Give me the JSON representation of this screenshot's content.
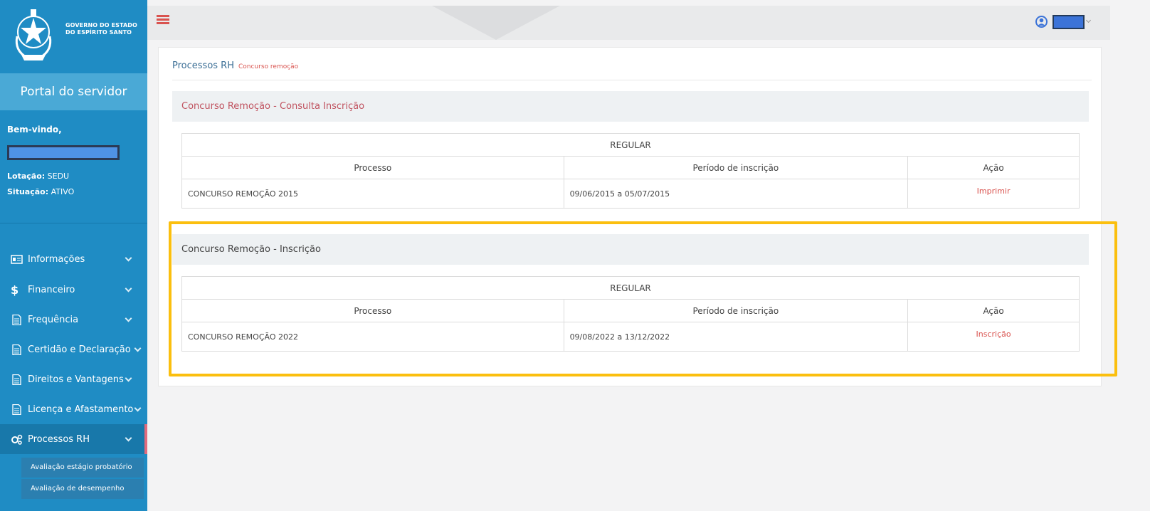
{
  "sidebar": {
    "gov_line1": "GOVERNO DO ESTADO",
    "gov_line2": "DO ESPÍRITO SANTO",
    "portal_title": "Portal do servidor",
    "welcome": "Bem-vindo,",
    "lotacao_label": "Lotação:",
    "lotacao_value": "SEDU",
    "situacao_label": "Situação:",
    "situacao_value": "ATIVO",
    "menu": [
      {
        "label": "Informações",
        "icon": "id-card-icon"
      },
      {
        "label": "Financeiro",
        "icon": "dollar-icon"
      },
      {
        "label": "Frequência",
        "icon": "document-icon"
      },
      {
        "label": "Certidão e Declaração",
        "icon": "document-icon"
      },
      {
        "label": "Direitos e Vantagens",
        "icon": "document-icon"
      },
      {
        "label": "Licença e Afastamento",
        "icon": "document-icon"
      },
      {
        "label": "Processos RH",
        "icon": "gears-icon"
      }
    ],
    "submenu": [
      "Avaliação estágio probatório",
      "Avaliação de desempenho"
    ]
  },
  "header": {
    "title": "Processos RH",
    "breadcrumb": "Concurso remoção"
  },
  "section_consulta": {
    "title": "Concurso Remoção - Consulta Inscrição",
    "group": "REGULAR",
    "columns": [
      "Processo",
      "Período de inscrição",
      "Ação"
    ],
    "rows": [
      {
        "processo": "CONCURSO REMOÇÃO 2015",
        "periodo": "09/06/2015 a 05/07/2015",
        "acao": "Imprimir"
      }
    ]
  },
  "section_inscricao": {
    "title": "Concurso Remoção - Inscrição",
    "group": "REGULAR",
    "columns": [
      "Processo",
      "Período de inscrição",
      "Ação"
    ],
    "rows": [
      {
        "processo": "CONCURSO REMOÇÃO 2022",
        "periodo": "09/08/2022 a 13/12/2022",
        "acao": "Inscrição"
      }
    ]
  },
  "colors": {
    "sidebar_bg": "#1f8cc4",
    "portal_bg": "#4aa9d6",
    "accent_red": "#d9534f",
    "highlight": "#fbbf0e"
  }
}
